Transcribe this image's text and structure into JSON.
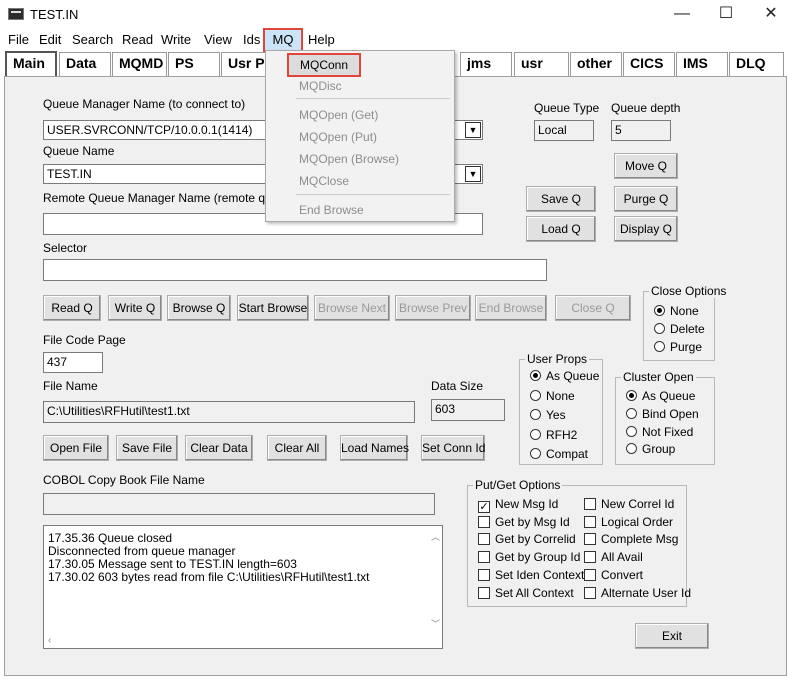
{
  "window": {
    "title": "TEST.IN",
    "min": "—",
    "max": "☐",
    "close": "✕"
  },
  "menubar": [
    "File",
    "Edit",
    "Search",
    "Read",
    "Write",
    "View",
    "Ids",
    "MQ",
    "Help"
  ],
  "tabs": [
    "Main",
    "Data",
    "MQMD",
    "PS",
    "Usr P",
    "jms",
    "usr",
    "other",
    "CICS",
    "IMS",
    "DLQ"
  ],
  "mq_menu": {
    "items": [
      "MQConn",
      "MQDisc",
      "MQOpen (Get)",
      "MQOpen (Put)",
      "MQOpen (Browse)",
      "MQClose",
      "End Browse"
    ],
    "highlighted": "MQConn"
  },
  "main": {
    "qm_label": "Queue Manager Name (to connect to)",
    "qm_value": "USER.SVRCONN/TCP/10.0.0.1(1414)",
    "queue_label": "Queue Name",
    "queue_value": "TEST.IN",
    "remote_label": "Remote Queue Manager Name (remote queues",
    "remote_value": "",
    "selector_label": "Selector",
    "selector_value": "",
    "queue_type_label": "Queue Type",
    "queue_type_value": "Local",
    "queue_depth_label": "Queue depth",
    "queue_depth_value": "5",
    "file_code_page_label": "File Code Page",
    "file_code_page_value": "437",
    "file_name_label": "File Name",
    "file_name_value": "C:\\Utilities\\RFHutil\\test1.txt",
    "data_size_label": "Data Size",
    "data_size_value": "603",
    "cobol_label": "COBOL Copy Book File Name",
    "cobol_value": ""
  },
  "buttons": {
    "move_q": "Move Q",
    "save_q": "Save Q",
    "purge_q": "Purge Q",
    "load_q": "Load Q",
    "display_q": "Display Q",
    "read_q": "Read Q",
    "write_q": "Write Q",
    "browse_q": "Browse Q",
    "start_browse": "Start Browse",
    "browse_next": "Browse Next",
    "browse_prev": "Browse Prev",
    "end_browse": "End Browse",
    "close_q": "Close Q",
    "open_file": "Open File",
    "save_file": "Save File",
    "clear_data": "Clear Data",
    "clear_all": "Clear All",
    "load_names": "Load Names",
    "set_conn_id": "Set Conn Id",
    "exit": "Exit"
  },
  "close_options": {
    "title": "Close Options",
    "options": [
      "None",
      "Delete",
      "Purge"
    ],
    "selected": "None"
  },
  "user_props": {
    "title": "User Props",
    "options": [
      "As Queue",
      "None",
      "Yes",
      "RFH2",
      "Compat"
    ],
    "selected": "As Queue"
  },
  "cluster_open": {
    "title": "Cluster Open",
    "options": [
      "As Queue",
      "Bind Open",
      "Not Fixed",
      "Group"
    ],
    "selected": "As Queue"
  },
  "put_get_options": {
    "title": "Put/Get Options",
    "left": [
      "New Msg Id",
      "Get by Msg Id",
      "Get by Correlid",
      "Get by Group Id",
      "Set Iden Context",
      "Set All Context"
    ],
    "right": [
      "New Correl Id",
      "Logical Order",
      "Complete Msg",
      "All Avail",
      "Convert",
      "Alternate User Id"
    ],
    "checked": [
      "New Msg Id"
    ]
  },
  "log": [
    "17.35.36 Queue closed",
    "Disconnected from queue manager",
    "17.30.05 Message sent to TEST.IN length=603",
    "17.30.02 603 bytes read from file C:\\Utilities\\RFHutil\\test1.txt"
  ]
}
